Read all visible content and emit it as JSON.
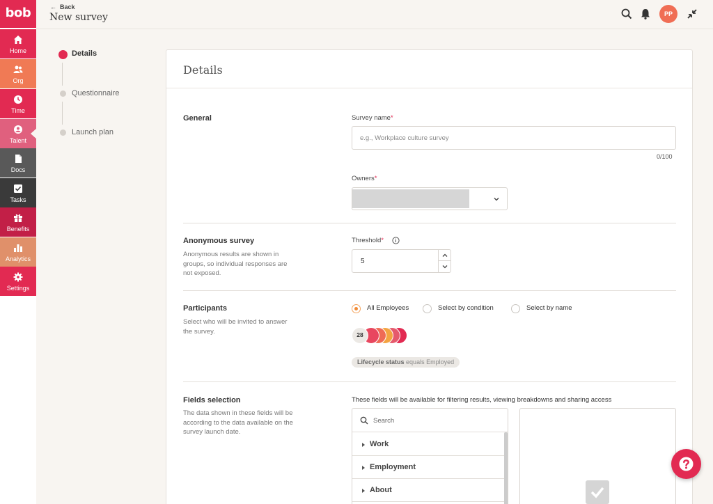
{
  "app": {
    "logo_text": "bob",
    "brand_color": "#e22a52"
  },
  "sidebar": {
    "items": [
      {
        "label": "Home",
        "icon": "home-icon",
        "color": "#e22a52"
      },
      {
        "label": "Org",
        "icon": "people-icon",
        "color": "#f07a55"
      },
      {
        "label": "Time",
        "icon": "clock-icon",
        "color": "#e22a52"
      },
      {
        "label": "Talent",
        "icon": "person-icon",
        "color": "#e0607e",
        "active": true
      },
      {
        "label": "Docs",
        "icon": "document-icon",
        "color": "#595959"
      },
      {
        "label": "Tasks",
        "icon": "checkbox-icon",
        "color": "#3a3a3a"
      },
      {
        "label": "Benefits",
        "icon": "gift-icon",
        "color": "#c21f47"
      },
      {
        "label": "Analytics",
        "icon": "bar-chart-icon",
        "color": "#e0906a"
      },
      {
        "label": "Settings",
        "icon": "gear-icon",
        "color": "#e22a52"
      }
    ]
  },
  "header": {
    "back_label": "Back",
    "title": "New survey",
    "avatar_initials": "PP"
  },
  "stepper": {
    "steps": [
      {
        "label": "Details",
        "state": "active"
      },
      {
        "label": "Questionnaire",
        "state": "pending"
      },
      {
        "label": "Launch plan",
        "state": "pending"
      }
    ]
  },
  "details": {
    "title": "Details",
    "general": {
      "title": "General",
      "survey_name_label": "Survey name",
      "survey_name_placeholder": "e.g., Workplace culture survey",
      "survey_name_value": "",
      "counter": "0/100",
      "owners_label": "Owners"
    },
    "anonymous": {
      "title": "Anonymous survey",
      "description": "Anonymous results are shown in groups, so individual responses are not exposed.",
      "threshold_label": "Threshold",
      "threshold_value": "5"
    },
    "participants": {
      "title": "Participants",
      "description": "Select who will be invited to answer the survey.",
      "options": [
        "All Employees",
        "Select by condition",
        "Select by name"
      ],
      "selected": "All Employees",
      "count": "28",
      "avatar_colors": [
        "#e8475f",
        "#ef6a55",
        "#f3a341",
        "#e55a6c",
        "#e22a52"
      ],
      "condition_field": "Lifecycle status",
      "condition_op": "equals",
      "condition_value": "Employed"
    },
    "fields_selection": {
      "title": "Fields selection",
      "description": "The data shown in these fields will be according to the data available on the survey launch date.",
      "note": "These fields will be available for filtering results, viewing breakdowns and sharing access",
      "search_placeholder": "Search",
      "groups": [
        "Work",
        "Employment",
        "About"
      ]
    }
  }
}
